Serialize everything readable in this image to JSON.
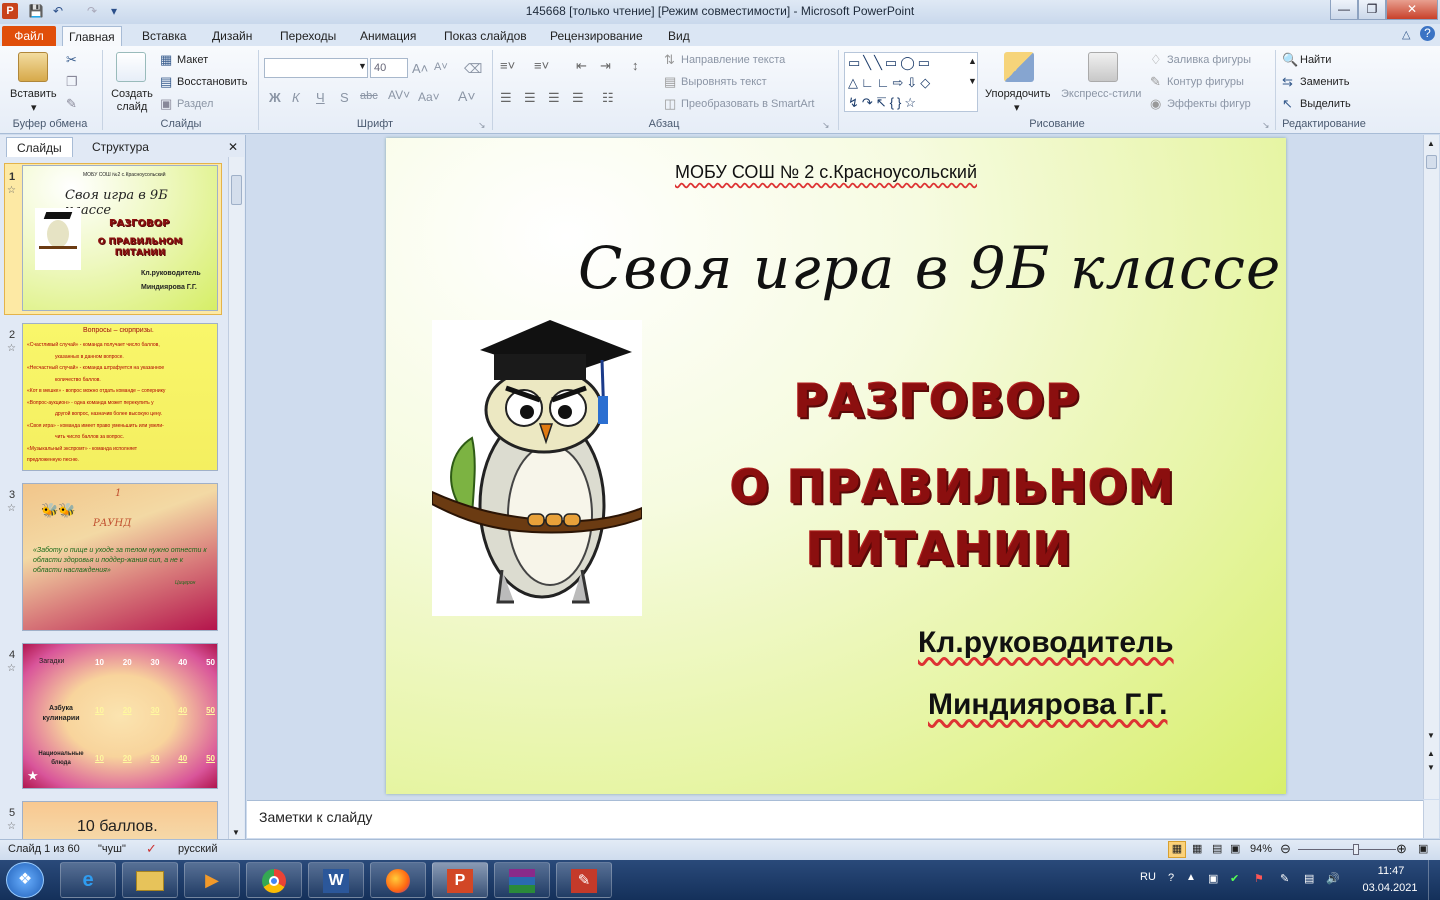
{
  "window": {
    "title": "145668 [только чтение] [Режим совместимости]  -  Microsoft PowerPoint"
  },
  "ribbon": {
    "tabs": [
      "Файл",
      "Главная",
      "Вставка",
      "Дизайн",
      "Переходы",
      "Анимация",
      "Показ слайдов",
      "Рецензирование",
      "Вид"
    ],
    "active_tab": "Главная",
    "clipboard": {
      "paste": "Вставить",
      "label": "Буфер обмена"
    },
    "slides": {
      "new_slide": "Создать слайд",
      "layout": "Макет",
      "reset": "Восстановить",
      "section": "Раздел",
      "label": "Слайды"
    },
    "font": {
      "font_size": "40",
      "label": "Шрифт",
      "bold": "Ж",
      "italic": "К",
      "underline": "Ч",
      "strike": "abc",
      "shadow": "S"
    },
    "paragraph": {
      "text_direction": "Направление текста",
      "align_text": "Выровнять текст",
      "smartart": "Преобразовать в SmartArt",
      "label": "Абзац"
    },
    "drawing": {
      "arrange": "Упорядочить",
      "quick_styles": "Экспресс-стили",
      "fill": "Заливка фигуры",
      "outline": "Контур фигуры",
      "effects": "Эффекты фигур",
      "label": "Рисование"
    },
    "editing": {
      "find": "Найти",
      "replace": "Заменить",
      "select": "Выделить",
      "label": "Редактирование"
    }
  },
  "panel": {
    "tabs": [
      "Слайды",
      "Структура"
    ],
    "thumbnails": [
      {
        "num": "1",
        "school": "МОБУ СОШ №2 с.Красноусольский",
        "title": "Своя игра в 9Б классе",
        "red1": "РАЗГОВОР",
        "red2": "О ПРАВИЛЬНОМ ПИТАНИИ",
        "author1": "Кл.руководитель",
        "author2": "Миндиярова  Г.Г."
      },
      {
        "num": "2",
        "heading": "Вопросы – сюрпризы.",
        "lines": [
          "«Счастливый  случай» - команда  получает  число  баллов,",
          "указанных в данном  вопросе.",
          "«Несчастный  случай» - команда штрафуется  на указанное",
          "количество баллов.",
          "«Кот в мешке» - вопрос можно  отдать команде  – сопернику",
          "«Вопрос-аукцион» - одна команда  может  перекупить  у",
          "другой вопрос, назначив  более  высокую  цену.",
          "«Своя игра» - команда  имеет  право  уменьшить  или  увели-",
          "чить число баллов за вопрос.",
          "«Музыкальный  экспромт» - команда  исполняет",
          "предложенную   песню."
        ]
      },
      {
        "num": "3",
        "number": "1",
        "round": "РАУНД",
        "quote": "«Заботу о пище и уходе за телом нужно отнести к области здоровья и поддер-жания сил, а не к области наслаждения»",
        "quote_author": "Цицерон"
      },
      {
        "num": "4",
        "rows": [
          {
            "label": "Загадки",
            "cells": [
              "10",
              "20",
              "30",
              "40",
              "50"
            ]
          },
          {
            "label": "Азбука кулинарии",
            "cells": [
              "10",
              "20",
              "30",
              "40",
              "50"
            ]
          },
          {
            "label": "Национальные блюда",
            "cells": [
              "10",
              "20",
              "30",
              "40",
              "50"
            ]
          }
        ]
      },
      {
        "num": "5",
        "text": "10 баллов."
      }
    ]
  },
  "slide": {
    "school": "МОБУ СОШ № 2 с.Красноусольский",
    "title": "Своя игра в 9Б классе",
    "red_line1": "РАЗГОВОР",
    "red_line2": "О ПРАВИЛЬНОМ",
    "red_line3": "ПИТАНИИ",
    "author_role": "Кл.руководитель",
    "author_name": "Миндиярова Г.Г."
  },
  "notes": {
    "placeholder": "Заметки к слайду"
  },
  "status": {
    "slide_info": "Слайд 1 из 60",
    "theme": "\"чуш\"",
    "language": "русский",
    "zoom": "94%",
    "zoom_fraction": 0.6
  },
  "taskbar": {
    "language": "RU",
    "time": "11:47",
    "date": "03.04.2021"
  }
}
